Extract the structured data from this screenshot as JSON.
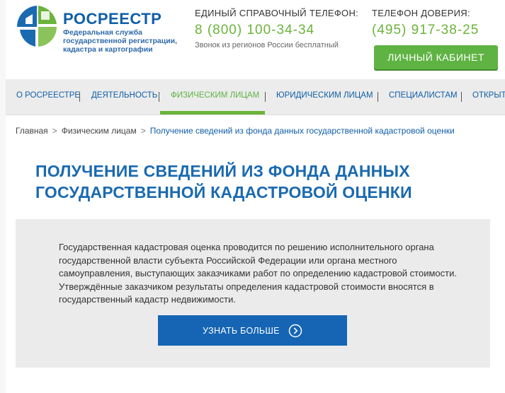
{
  "header": {
    "brand_name": "РОСРЕЕСТР",
    "brand_subtitle": "Федеральная служба государственной регистрации, кадастра и картографии",
    "hotline_title": "ЕДИНЫЙ СПРАВОЧНЫЙ ТЕЛЕФОН:",
    "hotline_number": "8 (800) 100-34-34",
    "hotline_note": "Звонок из регионов России бесплатный",
    "trust_title": "ТЕЛЕФОН ДОВЕРИЯ:",
    "trust_number": "(495) 917-38-25",
    "cabinet_button": "ЛИЧНЫЙ КАБИНЕТ"
  },
  "nav": {
    "items": [
      {
        "label": "О РОСРЕЕСТРЕ"
      },
      {
        "label": "ДЕЯТЕЛЬНОСТЬ"
      },
      {
        "label": "ФИЗИЧЕСКИМ ЛИЦАМ",
        "active": true
      },
      {
        "label": "ЮРИДИЧЕСКИМ ЛИЦАМ"
      },
      {
        "label": "СПЕЦИАЛИСТАМ"
      },
      {
        "label": "ОТКРЫТА"
      }
    ]
  },
  "breadcrumb": {
    "home": "Главная",
    "section": "Физическим лицам",
    "current": "Получение сведений из фонда данных государственной кадастровой оценки",
    "separator": ">"
  },
  "page": {
    "title": "ПОЛУЧЕНИЕ СВЕДЕНИЙ ИЗ ФОНДА ДАННЫХ ГОСУДАРСТВЕННОЙ КАДАСТРОВОЙ ОЦЕНКИ",
    "description": "Государственная кадастровая оценка проводится по решению исполнительного органа государственной власти субъекта Российской Федерации или органа местного самоуправления, выступающих заказчиками работ по определению кадастровой стоимости. Утверждённые заказчиком результаты определения кадастровой стоимости вносятся в государственный кадастр недвижимости.",
    "more_button": "УЗНАТЬ БОЛЬШЕ"
  },
  "colors": {
    "brand_blue": "#0f5ea8",
    "accent_green": "#5fb343",
    "button_blue": "#1565b4",
    "info_bg": "#ebebeb"
  },
  "icons": {
    "logo": "rosreestr-logo",
    "more_arrow": "chevron-right-circle-icon"
  }
}
